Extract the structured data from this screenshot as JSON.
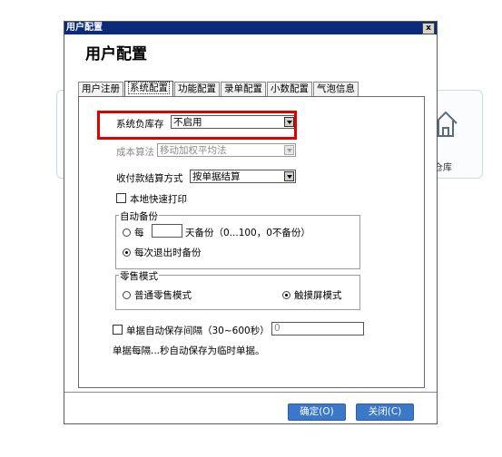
{
  "background": {
    "label": "仓库",
    "icon": "home-icon"
  },
  "dialog": {
    "titlebar": "用户配置",
    "close_label": "x",
    "title": "用户配置",
    "tabs": [
      "用户注册",
      "系统配置",
      "功能配置",
      "录单配置",
      "小数配置",
      "气泡信息"
    ],
    "active_tab": "系统配置",
    "system": {
      "inventory_label": "系统负库存",
      "inventory_value": "不启用",
      "cost_label": "成本算法",
      "cost_value": "移动加权平均法",
      "payment_label": "收付款结算方式",
      "payment_value": "按单据结算",
      "local_print": "本地快速打印"
    },
    "backup": {
      "title": "自动备份",
      "every_label": "每",
      "days_hint": "天备份（0...100，0不备份）",
      "on_exit_label": "每次退出时备份"
    },
    "retail": {
      "title": "零售模式",
      "normal_label": "普通零售模式",
      "touch_label": "触摸屏模式"
    },
    "autosave": {
      "label": "单据自动保存间隔（30~600秒）",
      "value": "0",
      "note": "单据每隔...秒自动保存为临时单据。"
    },
    "ok_label": "确定(O)",
    "close_button_label": "关闭(C)"
  },
  "colors": {
    "highlight": "#e00000",
    "button": "#3b78c9",
    "titlebar": "#0a2a7a"
  }
}
